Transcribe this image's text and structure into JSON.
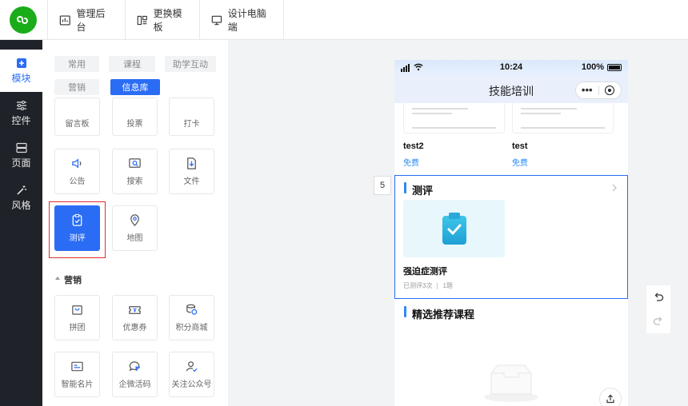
{
  "topbar": {
    "logo_icon": "mini-program-logo",
    "buttons": [
      {
        "label": "管理后台",
        "icon": "dashboard-icon"
      },
      {
        "label": "更换模板",
        "icon": "template-icon"
      },
      {
        "label": "设计电脑端",
        "icon": "monitor-icon"
      }
    ]
  },
  "leftnav": {
    "items": [
      {
        "label": "模块",
        "icon": "plus-square-icon",
        "active": true
      },
      {
        "label": "控件",
        "icon": "sliders-icon"
      },
      {
        "label": "页面",
        "icon": "pages-icon"
      },
      {
        "label": "风格",
        "icon": "magic-wand-icon"
      }
    ]
  },
  "panel": {
    "tabs": [
      "常用",
      "课程",
      "助学互动",
      "营销",
      "信息库"
    ],
    "active_tab": "信息库",
    "partial_cards": [
      "留言板",
      "投票",
      "打卡"
    ],
    "cards_row1": [
      "公告",
      "搜索",
      "文件"
    ],
    "cards_row2": [
      "测评",
      "地图"
    ],
    "selected_card": "测评",
    "section_marketing": "营销",
    "marketing_row1": [
      "拼团",
      "优惠券",
      "积分商城"
    ],
    "marketing_row2": [
      "智能名片",
      "企微活码",
      "关注公众号"
    ]
  },
  "phone": {
    "status_signal": "signal-icon",
    "time": "10:24",
    "battery": "100%",
    "title": "技能培训",
    "courses": [
      {
        "name": "test2",
        "price": "免费"
      },
      {
        "name": "test",
        "price": "免费"
      }
    ],
    "block_index": "5",
    "eval_section_title": "测评",
    "eval_item_name": "强迫症测评",
    "eval_item_meta1": "已测评3次",
    "eval_item_meta2": "1题",
    "recommend_title": "精选推荐课程"
  },
  "colors": {
    "accent": "#2b6cf5",
    "nav_dark": "#1f2329",
    "logo_green": "#1aad19",
    "highlight_red": "#e02e2e"
  }
}
